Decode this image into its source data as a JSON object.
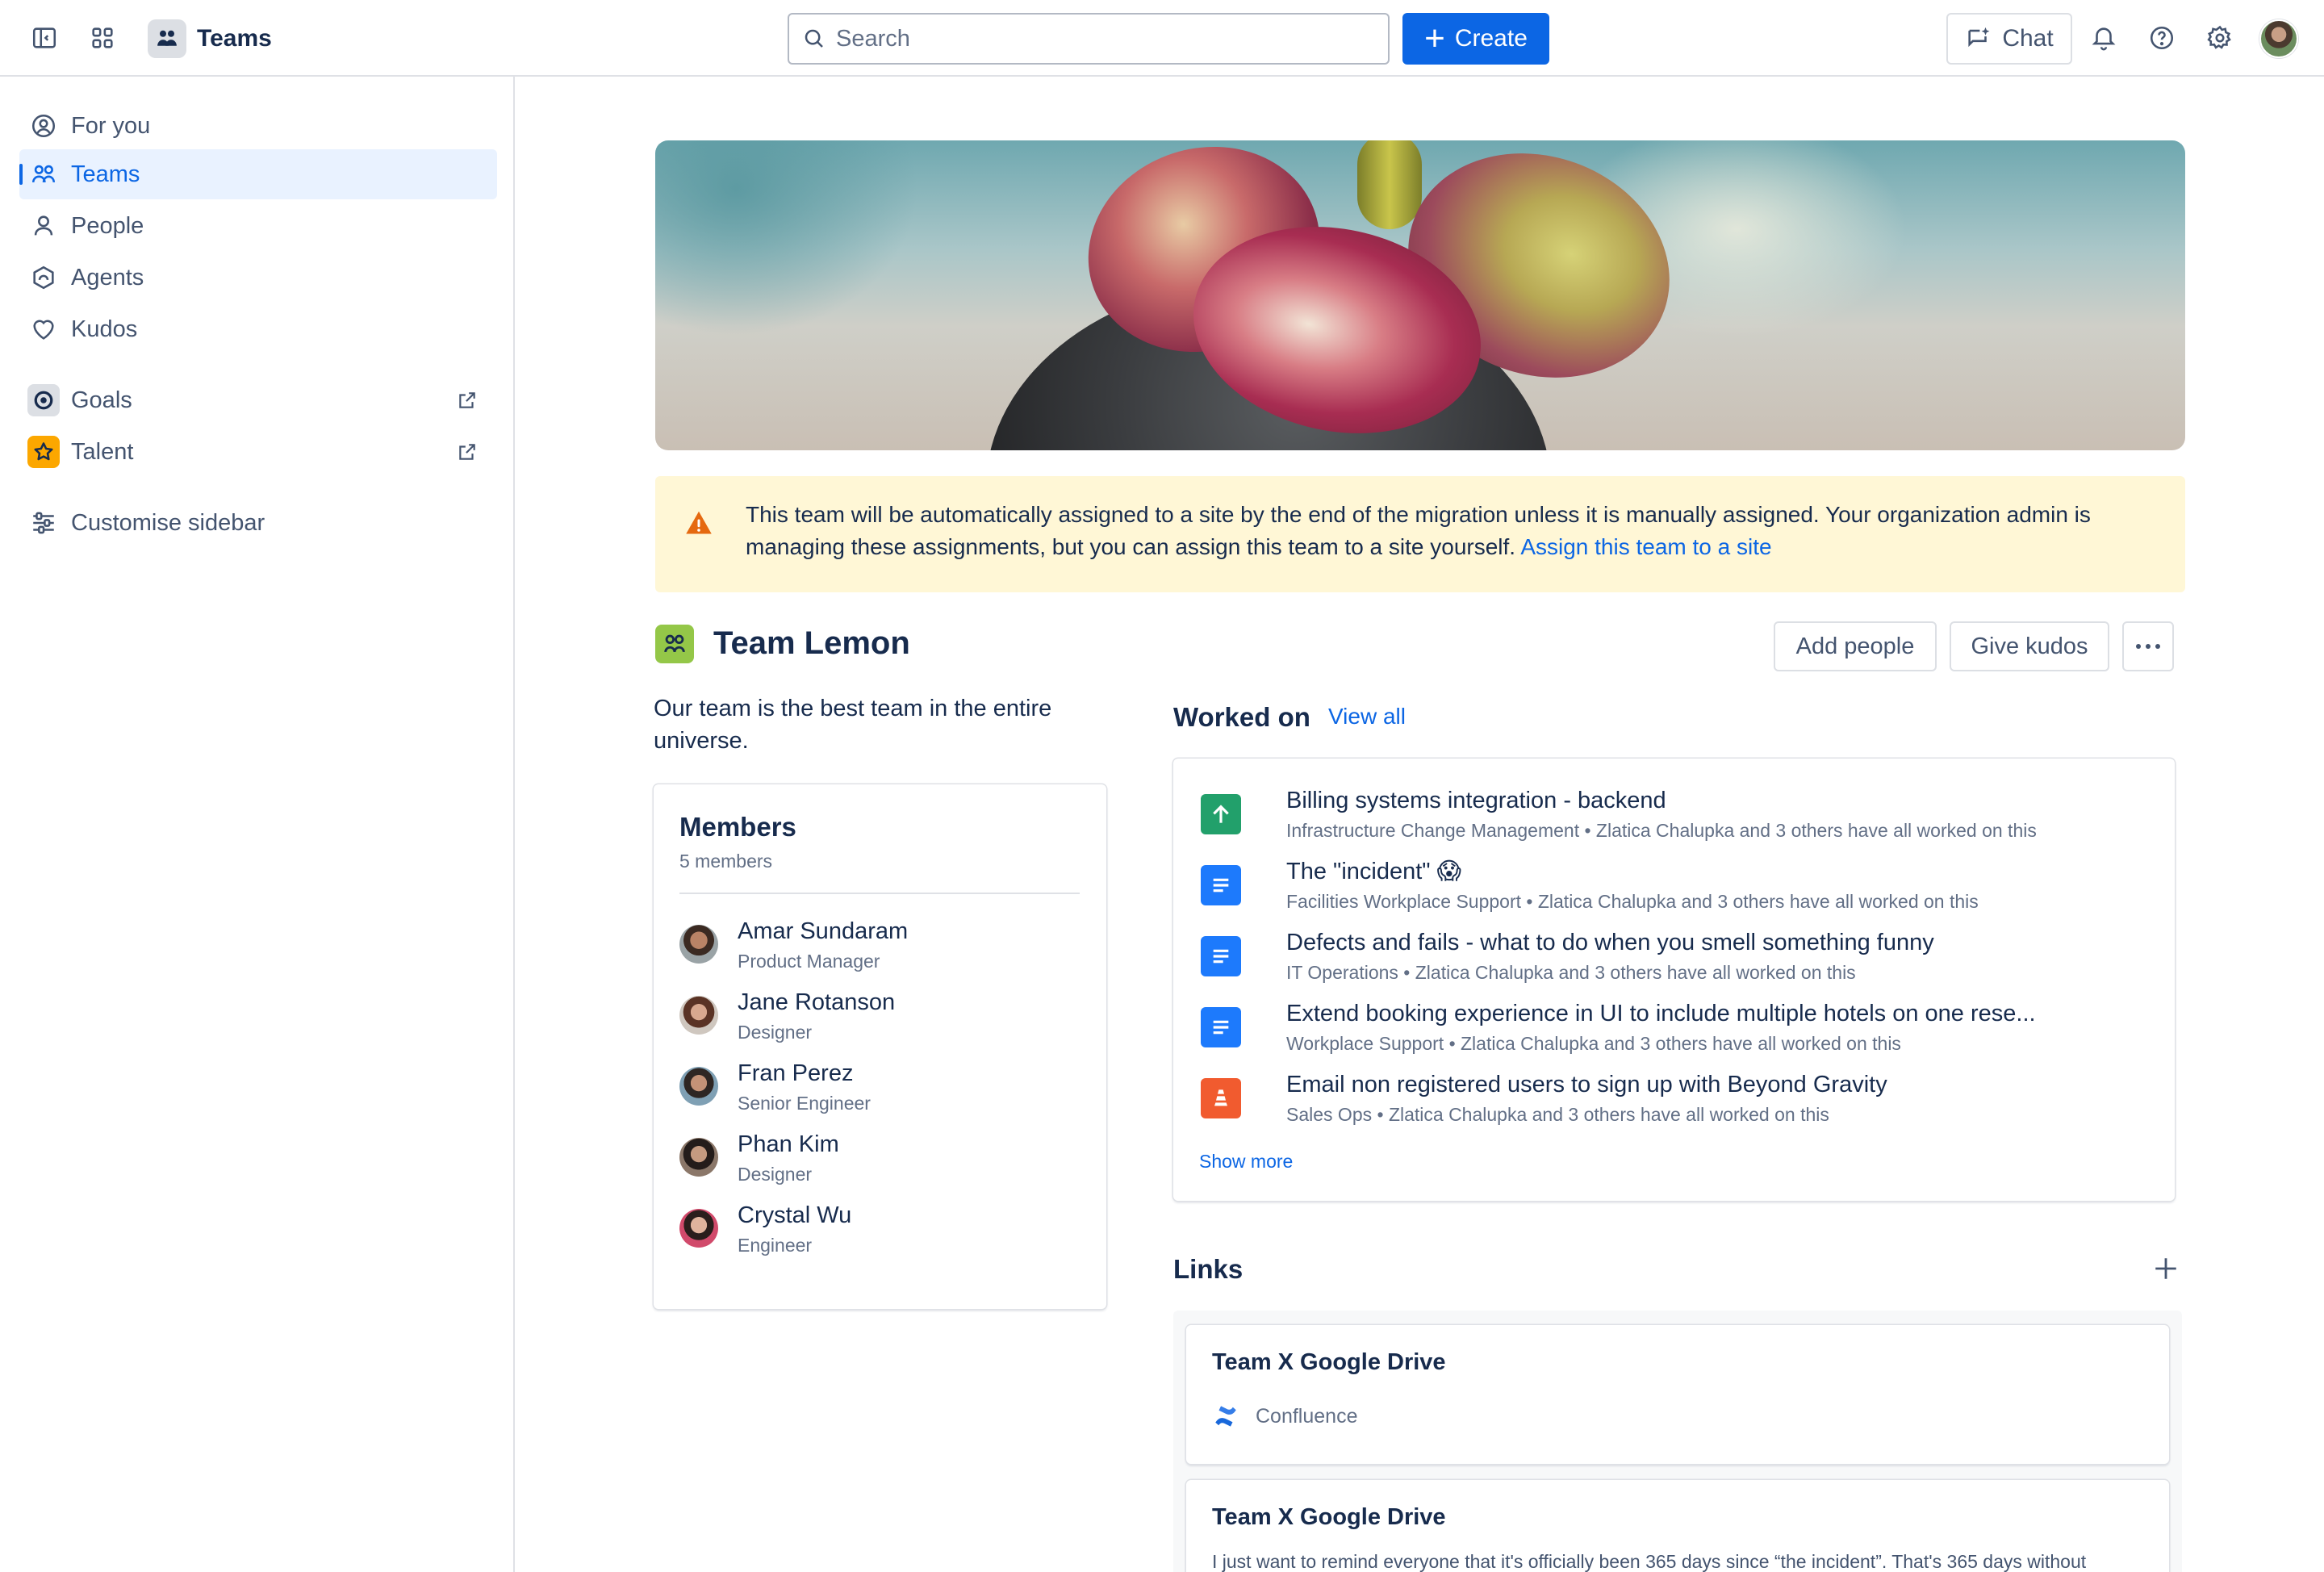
{
  "topbar": {
    "app_name": "Teams",
    "search_placeholder": "Search",
    "create_label": "Create",
    "chat_label": "Chat",
    "icons": [
      "sidebar-toggle-icon",
      "app-switcher-icon",
      "bell-icon",
      "help-icon",
      "gear-icon"
    ]
  },
  "sidebar": {
    "items": [
      {
        "label": "For you",
        "icon": "user-circle-icon"
      },
      {
        "label": "Teams",
        "icon": "people-icon",
        "active": true
      },
      {
        "label": "People",
        "icon": "person-icon"
      },
      {
        "label": "Agents",
        "icon": "agent-icon"
      },
      {
        "label": "Kudos",
        "icon": "heart-icon"
      }
    ],
    "apps": [
      {
        "label": "Goals",
        "icon": "goals-icon",
        "external": true
      },
      {
        "label": "Talent",
        "icon": "star-icon",
        "external": true
      }
    ],
    "customise_label": "Customise sidebar"
  },
  "banner": {
    "message": "This team will be automatically assigned to a site by the end of the migration unless it is manually assigned. Your organization admin is managing these assignments, but you can assign this team to a site yourself.",
    "link_text": "Assign this team to a site",
    "color": "#fff7d6"
  },
  "team": {
    "name": "Team Lemon",
    "description": "Our team is the best team in the entire universe.",
    "add_people_label": "Add people",
    "give_kudos_label": "Give kudos",
    "more_icon": "more-horizontal-icon"
  },
  "members": {
    "title": "Members",
    "count_label": "5 members",
    "list": [
      {
        "name": "Amar Sundaram",
        "role": "Product Manager"
      },
      {
        "name": "Jane Rotanson",
        "role": "Designer"
      },
      {
        "name": "Fran Perez",
        "role": "Senior Engineer"
      },
      {
        "name": "Phan Kim",
        "role": "Designer"
      },
      {
        "name": "Crystal Wu",
        "role": "Engineer"
      }
    ]
  },
  "worked_on": {
    "title": "Worked on",
    "view_all_label": "View all",
    "items": [
      {
        "title": "Billing systems integration - backend",
        "meta": "Infrastructure Change Management • Zlatica Chalupka and 3 others have all worked on this",
        "icon": "arrow-up-icon",
        "color": "#22a06b"
      },
      {
        "title": "The \"incident\" 😱",
        "meta": "Facilities Workplace Support • Zlatica Chalupka and 3 others have all worked on this",
        "icon": "page-icon",
        "color": "#1d7afc"
      },
      {
        "title": "Defects and fails - what to do when you smell something funny",
        "meta": "IT Operations • Zlatica Chalupka and 3 others have all worked on this",
        "icon": "page-icon",
        "color": "#1d7afc"
      },
      {
        "title": "Extend booking experience in UI to include multiple hotels on one rese...",
        "meta": "Workplace Support • Zlatica Chalupka and 3 others have all worked on this",
        "icon": "page-icon",
        "color": "#1d7afc"
      },
      {
        "title": "Email non registered users to sign up with Beyond Gravity",
        "meta": "Sales Ops • Zlatica Chalupka and 3 others have all worked on this",
        "icon": "cone-icon",
        "color": "#f15b2f"
      }
    ],
    "show_more_label": "Show more"
  },
  "links": {
    "title": "Links",
    "cards": [
      {
        "title": "Team X Google Drive",
        "source": "Confluence",
        "source_icon": "confluence-icon"
      },
      {
        "title": "Team X Google Drive",
        "body": "I just want to remind everyone that it's officially been 365 days since “the incident”. That's 365 days without"
      }
    ]
  }
}
